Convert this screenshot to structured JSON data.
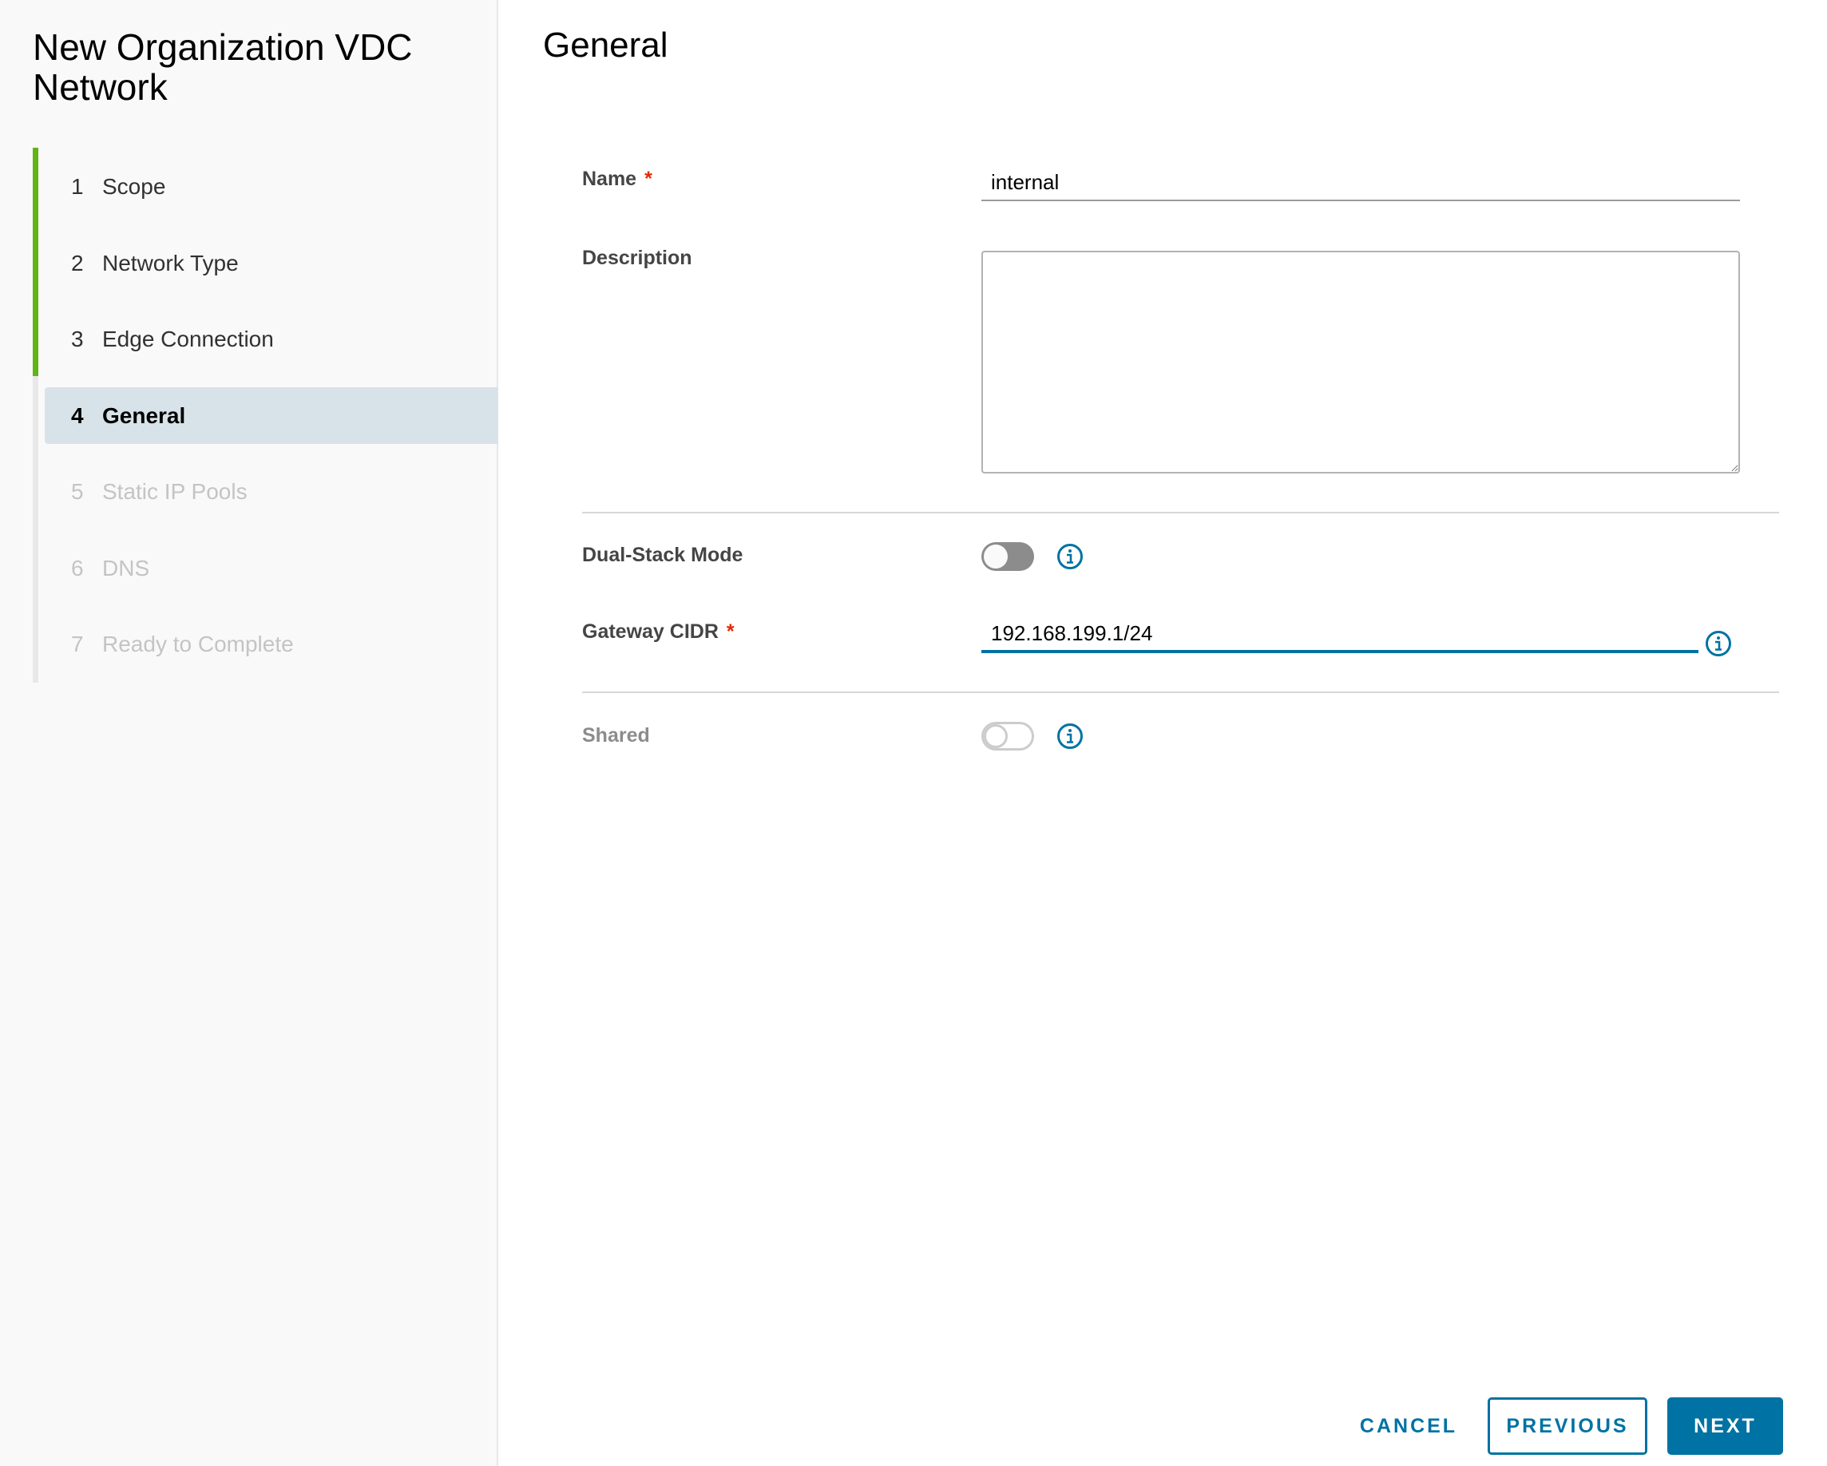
{
  "wizard": {
    "title": "New Organization VDC Network",
    "steps": [
      {
        "number": "1",
        "label": "Scope",
        "state": "completed"
      },
      {
        "number": "2",
        "label": "Network Type",
        "state": "completed"
      },
      {
        "number": "3",
        "label": "Edge Connection",
        "state": "completed"
      },
      {
        "number": "4",
        "label": "General",
        "state": "active"
      },
      {
        "number": "5",
        "label": "Static IP Pools",
        "state": "disabled"
      },
      {
        "number": "6",
        "label": "DNS",
        "state": "disabled"
      },
      {
        "number": "7",
        "label": "Ready to Complete",
        "state": "disabled"
      }
    ]
  },
  "page": {
    "title": "General",
    "required_marker": "*",
    "fields": {
      "name": {
        "label": "Name",
        "value": "internal",
        "required": true
      },
      "description": {
        "label": "Description",
        "value": ""
      },
      "dual_stack": {
        "label": "Dual-Stack Mode",
        "enabled": false
      },
      "gateway_cidr": {
        "label": "Gateway CIDR",
        "value": "192.168.199.1/24",
        "required": true
      },
      "shared": {
        "label": "Shared",
        "enabled": false,
        "disabled": true
      }
    }
  },
  "footer": {
    "cancel_label": "CANCEL",
    "previous_label": "PREVIOUS",
    "next_label": "NEXT"
  },
  "colors": {
    "accent": "#0072a3",
    "completed": "#60b515",
    "active_step_bg": "#d8e3e9",
    "required": "#e62700"
  }
}
